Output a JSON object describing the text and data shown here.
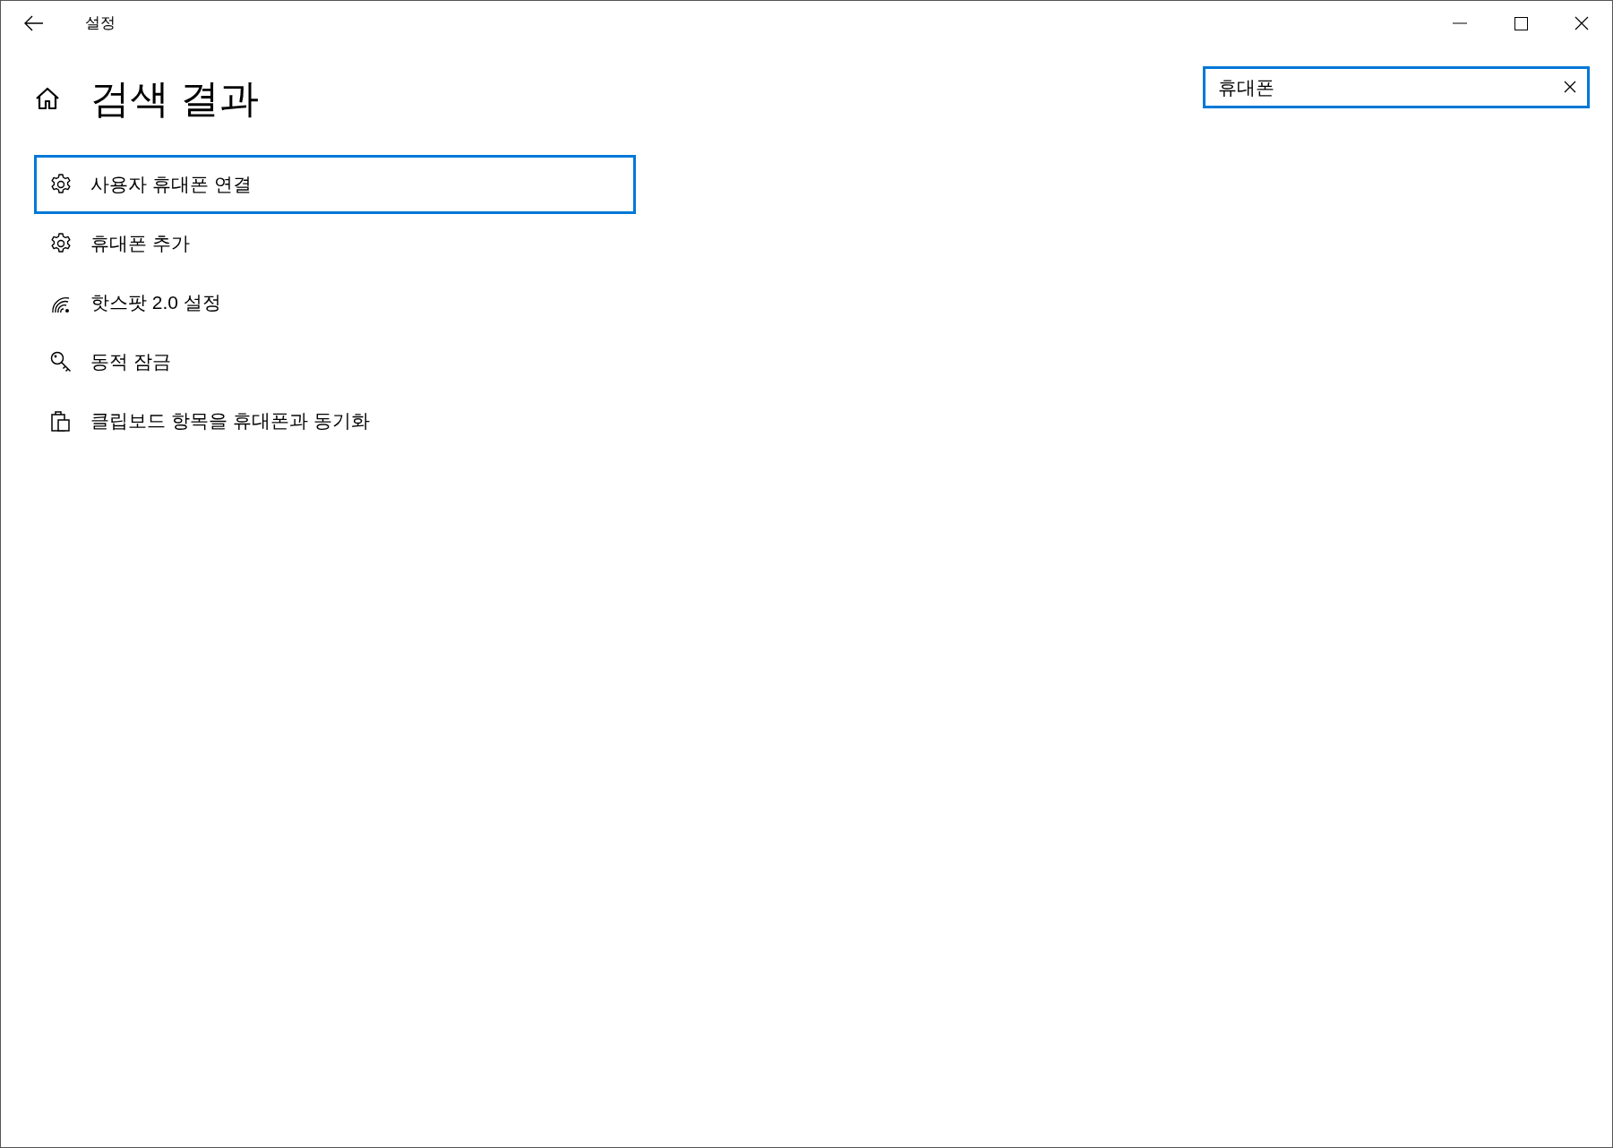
{
  "window": {
    "title": "설정"
  },
  "heading": "검색 결과",
  "search": {
    "value": "휴대폰"
  },
  "results": [
    {
      "label": "사용자 휴대폰 연결",
      "kind": "gear",
      "selected": true
    },
    {
      "label": "휴대폰 추가",
      "kind": "gear",
      "selected": false
    },
    {
      "label": "핫스팟 2.0 설정",
      "kind": "hotspot",
      "selected": false
    },
    {
      "label": "동적 잠금",
      "kind": "key",
      "selected": false
    },
    {
      "label": "클립보드 항목을 휴대폰과 동기화",
      "kind": "clipboard",
      "selected": false
    }
  ]
}
